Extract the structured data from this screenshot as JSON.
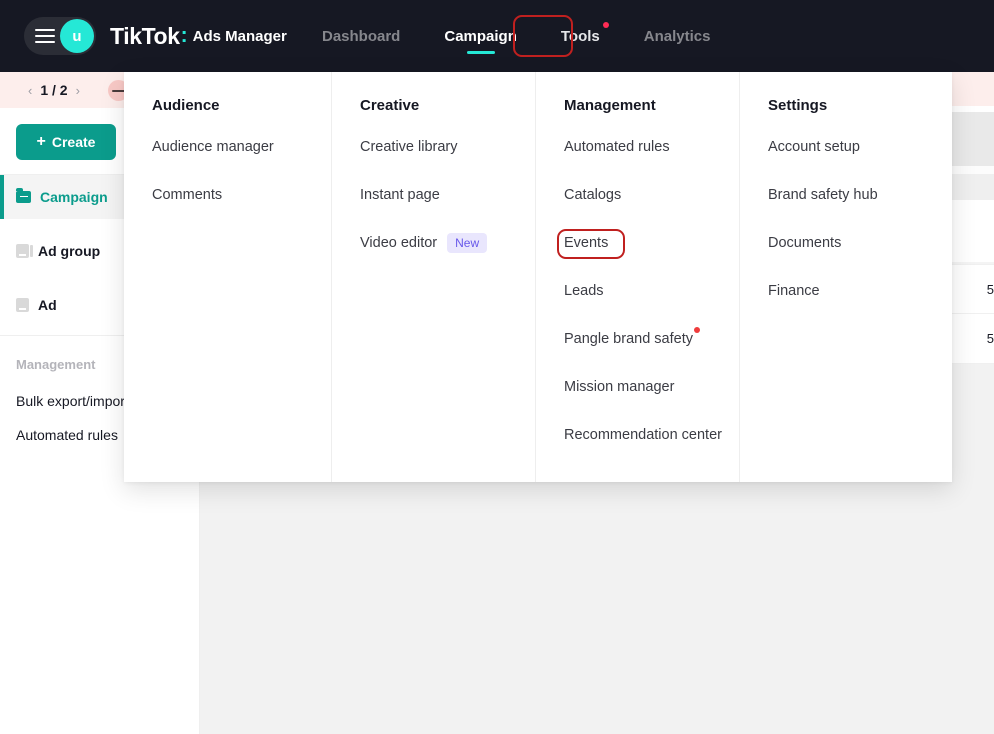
{
  "colors": {
    "nav_bg": "#161823",
    "brand_teal": "#25e8d6",
    "create_teal": "#0b9c8c",
    "annotation_red": "#c0201f",
    "badge_purple_text": "#6757ea",
    "badge_purple_bg": "#e9e6fd",
    "alert_dot_red": "#ef3c3c",
    "banner_pink": "#fdeeec"
  },
  "topbar": {
    "avatar_initial": "u",
    "brand_name": "TikTok",
    "brand_colon": ":",
    "brand_product": "Ads Manager",
    "nav": [
      {
        "label": "Dashboard",
        "active": false,
        "dot": false
      },
      {
        "label": "Campaign",
        "active": true,
        "dot": false
      },
      {
        "label": "Tools",
        "active": false,
        "dot": true
      },
      {
        "label": "Analytics",
        "active": false,
        "dot": false
      }
    ]
  },
  "sidebar": {
    "pager": {
      "prev": "‹",
      "label": "1 / 2",
      "next": "›"
    },
    "create_label": "Create",
    "create_plus": "+",
    "items": [
      {
        "label": "Campaign",
        "icon": "folder-icon",
        "active": true
      },
      {
        "label": "Ad group",
        "icon": "ad-group-icon",
        "active": false
      },
      {
        "label": "Ad",
        "icon": "ad-icon",
        "active": false
      }
    ],
    "section_title": "Management",
    "sub_items": [
      {
        "label": "Bulk export/import"
      },
      {
        "label": "Automated rules"
      }
    ]
  },
  "tools_menu": {
    "columns": [
      {
        "heading": "Audience",
        "items": [
          {
            "label": "Audience manager"
          },
          {
            "label": "Comments"
          }
        ]
      },
      {
        "heading": "Creative",
        "items": [
          {
            "label": "Creative library"
          },
          {
            "label": "Instant page"
          },
          {
            "label": "Video editor",
            "badge": "New"
          }
        ]
      },
      {
        "heading": "Management",
        "items": [
          {
            "label": "Automated rules"
          },
          {
            "label": "Catalogs"
          },
          {
            "label": "Events",
            "highlighted": true
          },
          {
            "label": "Leads"
          },
          {
            "label": "Pangle brand safety",
            "dot": true
          },
          {
            "label": "Mission manager"
          },
          {
            "label": "Recommendation center"
          }
        ]
      },
      {
        "heading": "Settings",
        "items": [
          {
            "label": "Account setup"
          },
          {
            "label": "Brand safety hub"
          },
          {
            "label": "Documents"
          },
          {
            "label": "Finance"
          }
        ]
      }
    ]
  },
  "background_table": {
    "partial_cells": [
      {
        "value": "5"
      },
      {
        "value": "5"
      }
    ]
  }
}
